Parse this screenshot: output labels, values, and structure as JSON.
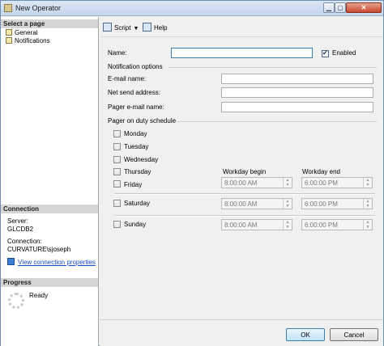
{
  "window": {
    "title": "New Operator",
    "controls": {
      "minimize": "▁",
      "maximize": "▢",
      "close": "✕"
    }
  },
  "left_pane": {
    "select_page_header": "Select a page",
    "pages": [
      "General",
      "Notifications"
    ],
    "connection_header": "Connection",
    "server_label": "Server:",
    "server_value": "GLCDB2",
    "connection_label": "Connection:",
    "connection_value": "CURVATURE\\sjoseph",
    "view_connection_link": "View connection properties",
    "progress_header": "Progress",
    "progress_status": "Ready"
  },
  "toolbar": {
    "script_label": "Script",
    "script_arrow": "▼",
    "help_label": "Help"
  },
  "form": {
    "name_label": "Name:",
    "name_value": "",
    "enabled_label": "Enabled",
    "enabled_checked": true,
    "notification_options_label": "Notification options",
    "email_label": "E-mail name:",
    "net_send_label": "Net send address:",
    "pager_email_label": "Pager e-mail name:",
    "pager_schedule_label": "Pager on duty schedule",
    "days": [
      "Monday",
      "Tuesday",
      "Wednesday",
      "Thursday",
      "Friday",
      "Saturday",
      "Sunday"
    ],
    "workday_begin_label": "Workday begin",
    "workday_end_label": "Workday end",
    "weekday_begin": "8:00:00 AM",
    "weekday_end": "6:00:00 PM",
    "saturday_begin": "8:00:00 AM",
    "saturday_end": "6:00:00 PM",
    "sunday_begin": "8:00:00 AM",
    "sunday_end": "6:00:00 PM",
    "spin_up": "▲",
    "spin_down": "▼"
  },
  "footer": {
    "ok_label": "OK",
    "cancel_label": "Cancel"
  }
}
